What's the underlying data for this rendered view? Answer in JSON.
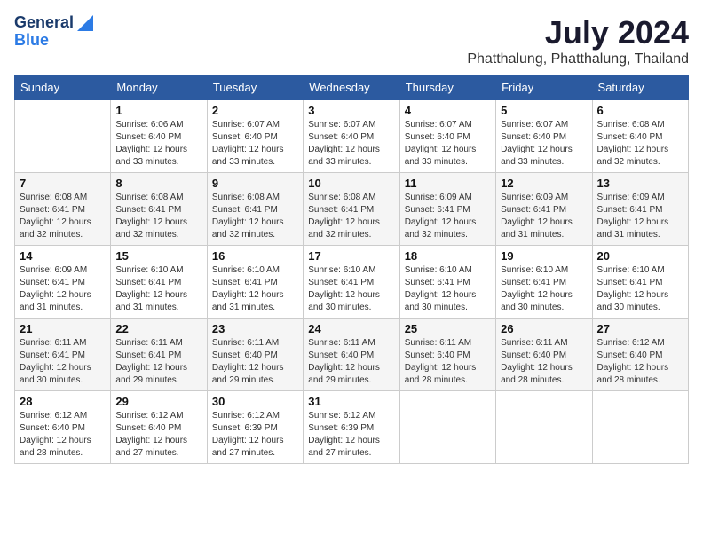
{
  "header": {
    "logo_line1": "General",
    "logo_line2": "Blue",
    "month": "July 2024",
    "location": "Phatthalung, Phatthalung, Thailand"
  },
  "weekdays": [
    "Sunday",
    "Monday",
    "Tuesday",
    "Wednesday",
    "Thursday",
    "Friday",
    "Saturday"
  ],
  "weeks": [
    [
      {
        "day": "",
        "info": ""
      },
      {
        "day": "1",
        "info": "Sunrise: 6:06 AM\nSunset: 6:40 PM\nDaylight: 12 hours\nand 33 minutes."
      },
      {
        "day": "2",
        "info": "Sunrise: 6:07 AM\nSunset: 6:40 PM\nDaylight: 12 hours\nand 33 minutes."
      },
      {
        "day": "3",
        "info": "Sunrise: 6:07 AM\nSunset: 6:40 PM\nDaylight: 12 hours\nand 33 minutes."
      },
      {
        "day": "4",
        "info": "Sunrise: 6:07 AM\nSunset: 6:40 PM\nDaylight: 12 hours\nand 33 minutes."
      },
      {
        "day": "5",
        "info": "Sunrise: 6:07 AM\nSunset: 6:40 PM\nDaylight: 12 hours\nand 33 minutes."
      },
      {
        "day": "6",
        "info": "Sunrise: 6:08 AM\nSunset: 6:40 PM\nDaylight: 12 hours\nand 32 minutes."
      }
    ],
    [
      {
        "day": "7",
        "info": "Sunrise: 6:08 AM\nSunset: 6:41 PM\nDaylight: 12 hours\nand 32 minutes."
      },
      {
        "day": "8",
        "info": "Sunrise: 6:08 AM\nSunset: 6:41 PM\nDaylight: 12 hours\nand 32 minutes."
      },
      {
        "day": "9",
        "info": "Sunrise: 6:08 AM\nSunset: 6:41 PM\nDaylight: 12 hours\nand 32 minutes."
      },
      {
        "day": "10",
        "info": "Sunrise: 6:08 AM\nSunset: 6:41 PM\nDaylight: 12 hours\nand 32 minutes."
      },
      {
        "day": "11",
        "info": "Sunrise: 6:09 AM\nSunset: 6:41 PM\nDaylight: 12 hours\nand 32 minutes."
      },
      {
        "day": "12",
        "info": "Sunrise: 6:09 AM\nSunset: 6:41 PM\nDaylight: 12 hours\nand 31 minutes."
      },
      {
        "day": "13",
        "info": "Sunrise: 6:09 AM\nSunset: 6:41 PM\nDaylight: 12 hours\nand 31 minutes."
      }
    ],
    [
      {
        "day": "14",
        "info": "Sunrise: 6:09 AM\nSunset: 6:41 PM\nDaylight: 12 hours\nand 31 minutes."
      },
      {
        "day": "15",
        "info": "Sunrise: 6:10 AM\nSunset: 6:41 PM\nDaylight: 12 hours\nand 31 minutes."
      },
      {
        "day": "16",
        "info": "Sunrise: 6:10 AM\nSunset: 6:41 PM\nDaylight: 12 hours\nand 31 minutes."
      },
      {
        "day": "17",
        "info": "Sunrise: 6:10 AM\nSunset: 6:41 PM\nDaylight: 12 hours\nand 30 minutes."
      },
      {
        "day": "18",
        "info": "Sunrise: 6:10 AM\nSunset: 6:41 PM\nDaylight: 12 hours\nand 30 minutes."
      },
      {
        "day": "19",
        "info": "Sunrise: 6:10 AM\nSunset: 6:41 PM\nDaylight: 12 hours\nand 30 minutes."
      },
      {
        "day": "20",
        "info": "Sunrise: 6:10 AM\nSunset: 6:41 PM\nDaylight: 12 hours\nand 30 minutes."
      }
    ],
    [
      {
        "day": "21",
        "info": "Sunrise: 6:11 AM\nSunset: 6:41 PM\nDaylight: 12 hours\nand 30 minutes."
      },
      {
        "day": "22",
        "info": "Sunrise: 6:11 AM\nSunset: 6:41 PM\nDaylight: 12 hours\nand 29 minutes."
      },
      {
        "day": "23",
        "info": "Sunrise: 6:11 AM\nSunset: 6:40 PM\nDaylight: 12 hours\nand 29 minutes."
      },
      {
        "day": "24",
        "info": "Sunrise: 6:11 AM\nSunset: 6:40 PM\nDaylight: 12 hours\nand 29 minutes."
      },
      {
        "day": "25",
        "info": "Sunrise: 6:11 AM\nSunset: 6:40 PM\nDaylight: 12 hours\nand 28 minutes."
      },
      {
        "day": "26",
        "info": "Sunrise: 6:11 AM\nSunset: 6:40 PM\nDaylight: 12 hours\nand 28 minutes."
      },
      {
        "day": "27",
        "info": "Sunrise: 6:12 AM\nSunset: 6:40 PM\nDaylight: 12 hours\nand 28 minutes."
      }
    ],
    [
      {
        "day": "28",
        "info": "Sunrise: 6:12 AM\nSunset: 6:40 PM\nDaylight: 12 hours\nand 28 minutes."
      },
      {
        "day": "29",
        "info": "Sunrise: 6:12 AM\nSunset: 6:40 PM\nDaylight: 12 hours\nand 27 minutes."
      },
      {
        "day": "30",
        "info": "Sunrise: 6:12 AM\nSunset: 6:39 PM\nDaylight: 12 hours\nand 27 minutes."
      },
      {
        "day": "31",
        "info": "Sunrise: 6:12 AM\nSunset: 6:39 PM\nDaylight: 12 hours\nand 27 minutes."
      },
      {
        "day": "",
        "info": ""
      },
      {
        "day": "",
        "info": ""
      },
      {
        "day": "",
        "info": ""
      }
    ]
  ]
}
